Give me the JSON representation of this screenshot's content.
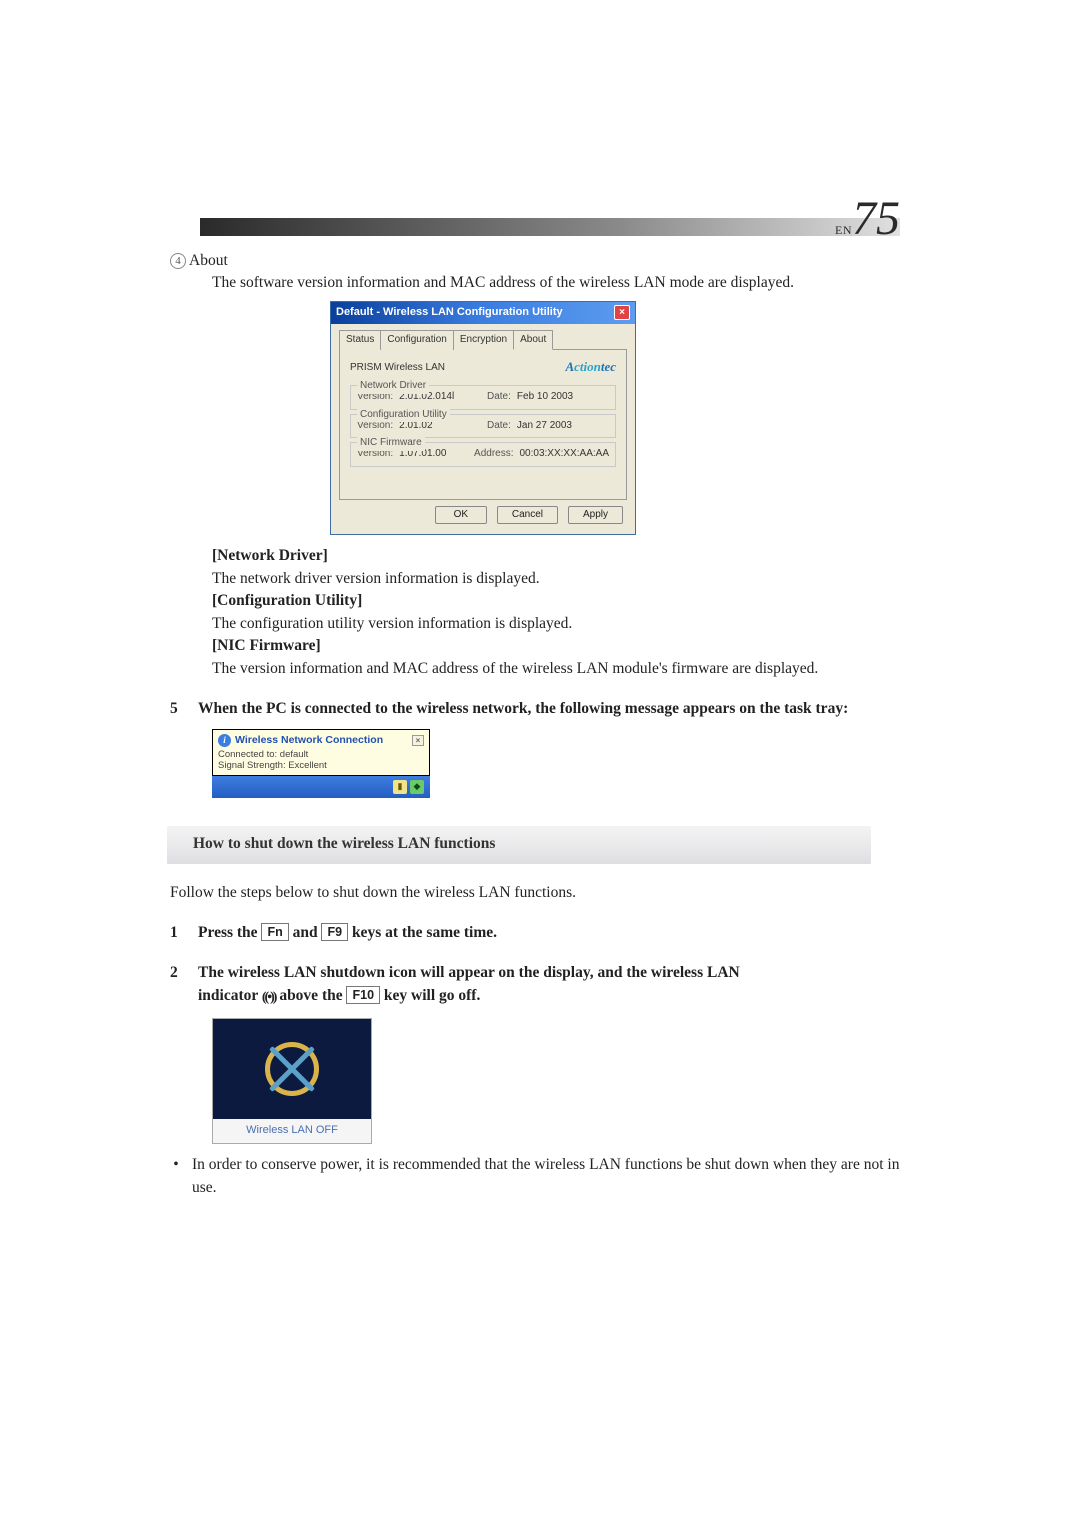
{
  "page": {
    "en_label": "EN",
    "number": "75"
  },
  "about": {
    "num_symbol": "4",
    "title": "About",
    "intro": "The software version information and MAC address of the wireless LAN mode are displayed."
  },
  "dialog": {
    "title": "Default - Wireless LAN Configuration Utility",
    "tabs": [
      "Status",
      "Configuration",
      "Encryption",
      "About"
    ],
    "prism": "PRISM Wireless LAN",
    "brand": "Actiontec",
    "network_driver": {
      "legend": "Network Driver",
      "version_label": "Version:",
      "version": "2.01.02.014l",
      "date_label": "Date:",
      "date": "Feb 10 2003"
    },
    "config_utility": {
      "legend": "Configuration Utility",
      "version_label": "Version:",
      "version": "2.01.02",
      "date_label": "Date:",
      "date": "Jan 27 2003"
    },
    "nic_firmware": {
      "legend": "NIC Firmware",
      "version_label": "Version:",
      "version": "1.07.01.00",
      "address_label": "Address:",
      "address": "00:03:XX:XX:AA:AA"
    },
    "buttons": {
      "ok": "OK",
      "cancel": "Cancel",
      "apply": "Apply"
    }
  },
  "definitions": {
    "nd_head": "[Network Driver]",
    "nd_text": "The network driver version information is displayed.",
    "cu_head": "[Configuration Utility]",
    "cu_text": "The configuration utility version information is displayed.",
    "nf_head": "[NIC Firmware]",
    "nf_text": "The version information and MAC address of the wireless LAN module's firmware are displayed."
  },
  "step5": {
    "num": "5",
    "text": "When the PC is connected to the wireless network, the following message appears on the task tray:"
  },
  "tray": {
    "title": "Wireless Network Connection",
    "line1": "Connected to: default",
    "line2": "Signal Strength: Excellent"
  },
  "section": {
    "title": "How to shut down the wireless LAN functions"
  },
  "follow": "Follow the steps below to shut down the wireless LAN functions.",
  "shut1": {
    "num": "1",
    "pre": "Press the ",
    "key1": "Fn",
    "mid": " and ",
    "key2": "F9",
    "post": " keys at the same time."
  },
  "shut2": {
    "num": "2",
    "line1a": "The wireless LAN shutdown icon will appear on the display, and the wireless LAN",
    "line2a": "indicator ",
    "line2b": " above the ",
    "key": "F10",
    "line2c": " key will go off."
  },
  "wlan_off": "Wireless LAN OFF",
  "tip": {
    "bullet": "•",
    "text": "In order to conserve power, it is recommended that the wireless LAN functions be shut down when they are not in use."
  }
}
